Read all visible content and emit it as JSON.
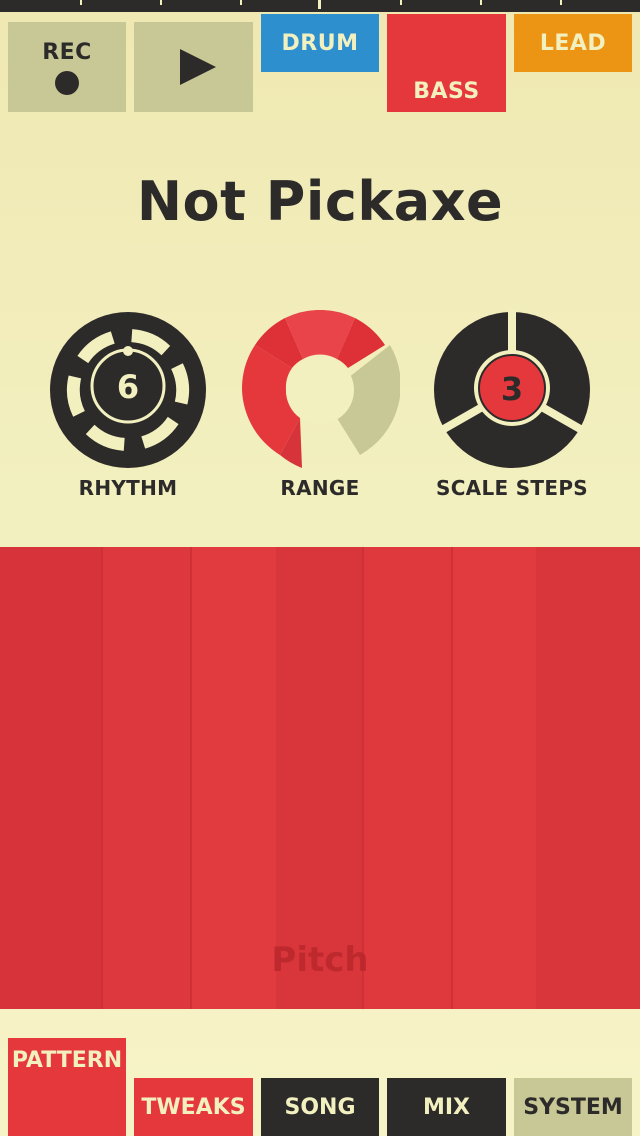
{
  "transport": {
    "rec_label": "REC",
    "rec_icon": "record-dot",
    "play_icon": "play-triangle"
  },
  "instrument_tabs": [
    {
      "label": "DRUM",
      "color": "#2e8fce"
    },
    {
      "label": "BASS",
      "color": "#e5383d",
      "selected": true
    },
    {
      "label": "LEAD",
      "color": "#ec9414"
    }
  ],
  "pattern_name": "Not Pickaxe",
  "knobs": {
    "rhythm": {
      "label": "RHYTHM",
      "value": "6"
    },
    "range": {
      "label": "RANGE"
    },
    "scale_steps": {
      "label": "SCALE STEPS",
      "value": "3"
    }
  },
  "pad_area": {
    "label": "Pitch",
    "columns": 7
  },
  "bottom_tabs": [
    {
      "label": "PATTERN",
      "selected": true
    },
    {
      "label": "TWEAKS"
    },
    {
      "label": "SONG"
    },
    {
      "label": "MIX"
    },
    {
      "label": "SYSTEM"
    }
  ],
  "colors": {
    "background": "#f3f0c0",
    "dark": "#2d2b2a",
    "red": "#e5383d",
    "khaki": "#c8c796",
    "blue": "#2e8fce",
    "orange": "#ec9414"
  }
}
